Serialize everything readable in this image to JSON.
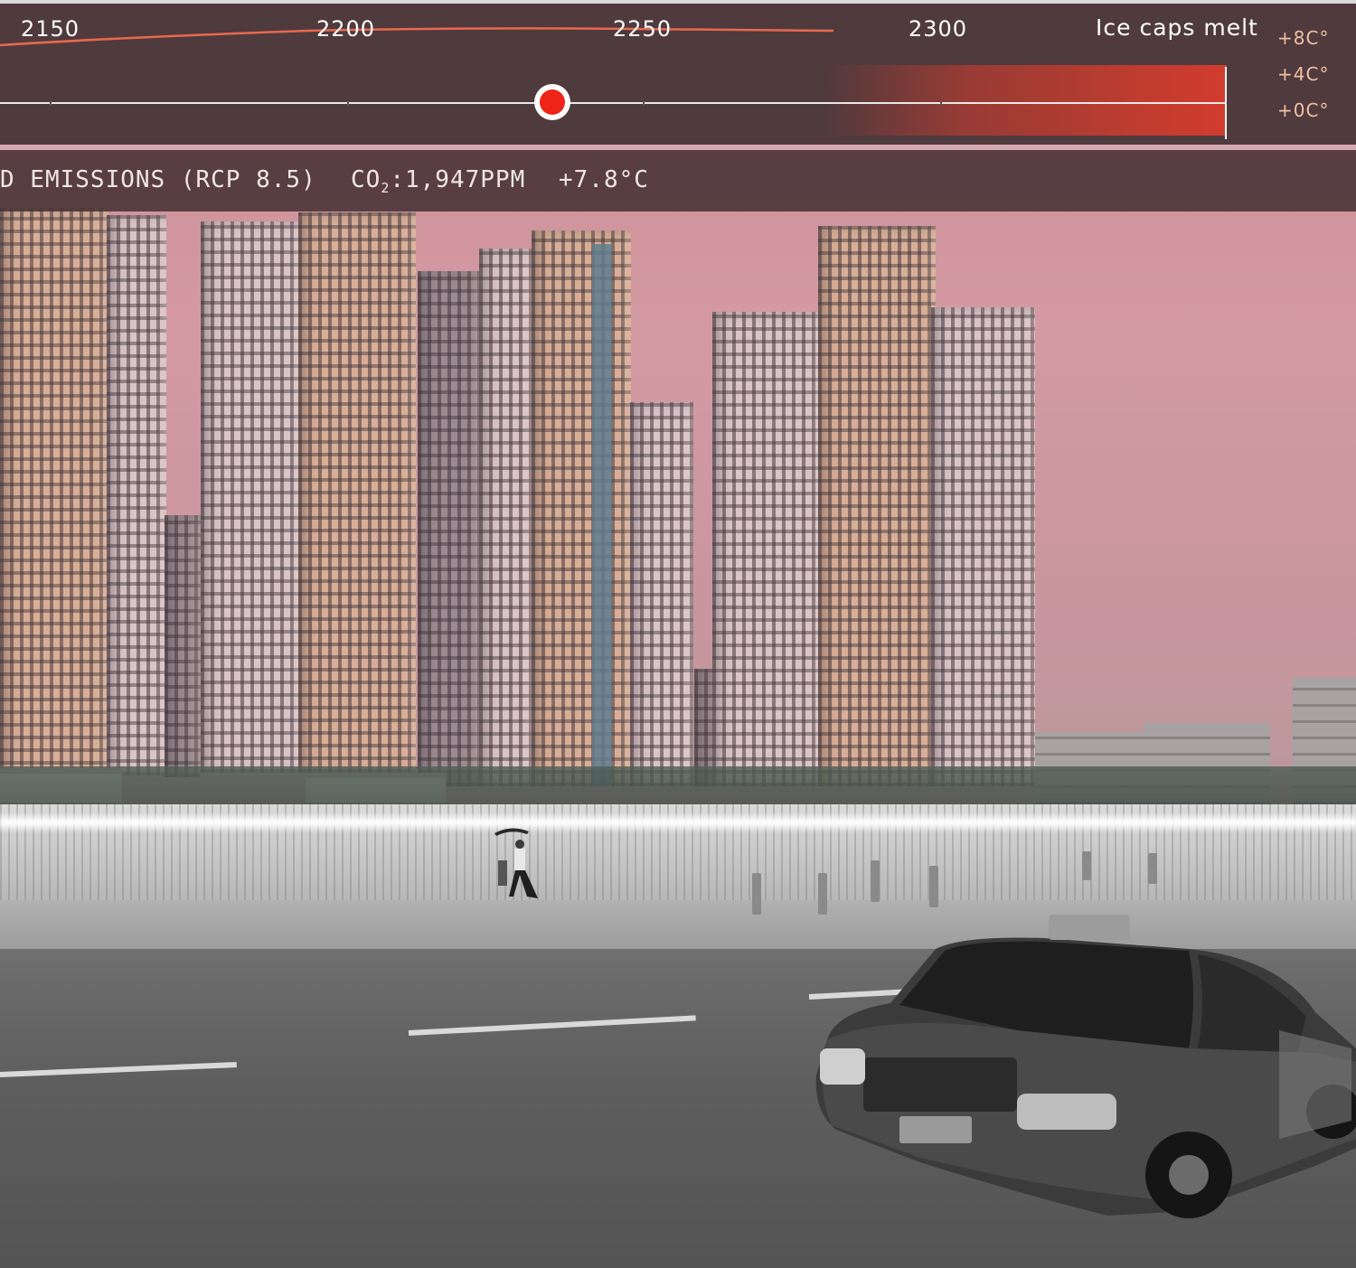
{
  "timeline": {
    "years": [
      "2150",
      "2200",
      "2250",
      "2300"
    ],
    "milestone": "Ice caps melt",
    "temperature_scale": [
      "+8C°",
      "+4C°",
      "+0C°"
    ],
    "slider_position": 0.45
  },
  "status": {
    "scenario": "D EMISSIONS (RCP 8.5)",
    "co2_prefix": "CO",
    "co2_subscript": "2",
    "co2_value": ":1,947PPM",
    "temperature": "+7.8°C"
  },
  "icons": {
    "slider": "slider-thumb-icon"
  },
  "colors": {
    "accent": "#ee2418",
    "heat_bar": "#d23c2d",
    "temp_labels": "#f1c2a3"
  }
}
